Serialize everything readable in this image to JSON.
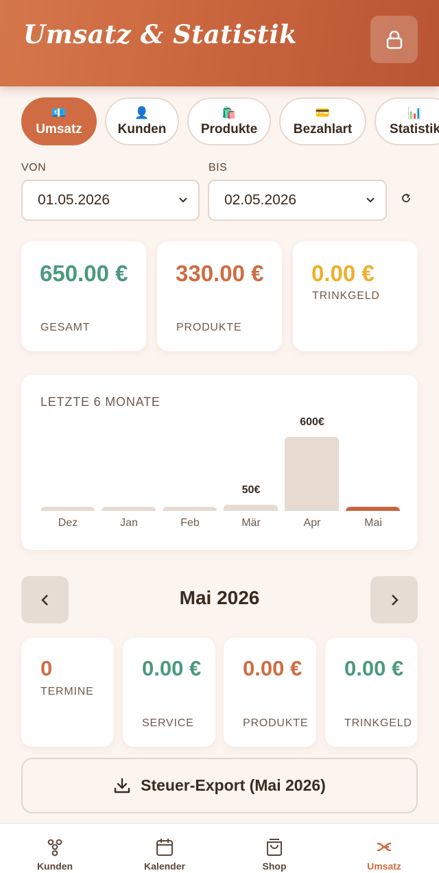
{
  "header": {
    "title": "Umsatz & Statistik",
    "lock_icon": "lock-icon"
  },
  "tabs": [
    {
      "icon": "💶",
      "label": "Umsatz",
      "active": true
    },
    {
      "icon": "👤",
      "label": "Kunden",
      "active": false
    },
    {
      "icon": "🛍️",
      "label": "Produkte",
      "active": false
    },
    {
      "icon": "💳",
      "label": "Bezahlart",
      "active": false
    },
    {
      "icon": "📊",
      "label": "Statistik",
      "active": false
    }
  ],
  "filter": {
    "from_label": "VON",
    "from_value": "01.05.2026",
    "to_label": "BIS",
    "to_value": "02.05.2026",
    "refresh_icon": "↻"
  },
  "summary": [
    {
      "value": "650.00 €",
      "label": "GESAMT",
      "color": "#4b9a7c"
    },
    {
      "value": "330.00 €",
      "label": "PRODUKTE",
      "color": "#cf6c43"
    },
    {
      "value": "0.00 €",
      "label": "TRINKGELD",
      "color": "#eeb02a"
    }
  ],
  "chart_data": {
    "type": "bar",
    "title": "LETZTE 6 MONATE",
    "categories": [
      "Dez",
      "Jan",
      "Feb",
      "Mär",
      "Apr",
      "Mai"
    ],
    "values": [
      0,
      0,
      0,
      50,
      600,
      0
    ],
    "value_labels": [
      "",
      "",
      "",
      "50€",
      "600€",
      ""
    ],
    "highlight_category": "Mai",
    "ylim": [
      0,
      600
    ],
    "grid": false
  },
  "month_nav": {
    "title": "Mai 2026",
    "prev": "‹",
    "next": "›"
  },
  "month_stats": [
    {
      "value": "0",
      "label": "TERMINE",
      "color": "#cf6c43"
    },
    {
      "value": "0.00 €",
      "label": "SERVICE",
      "color": "#4b9a7c"
    },
    {
      "value": "0.00 €",
      "label": "PRODUKTE",
      "color": "#cf6c43"
    },
    {
      "value": "0.00 €",
      "label": "TRINKGELD",
      "color": "#4b9a7c"
    }
  ],
  "export": {
    "label": "Steuer-Export (Mai 2026)",
    "icon": "download-icon"
  },
  "bottom_nav": [
    {
      "label": "Kunden",
      "icon": "users-icon",
      "active": false
    },
    {
      "label": "Kalender",
      "icon": "calendar-icon",
      "active": false
    },
    {
      "label": "Shop",
      "icon": "shopping-bag-icon",
      "active": false
    },
    {
      "label": "Umsatz",
      "icon": "revenue-icon",
      "active": true
    }
  ]
}
